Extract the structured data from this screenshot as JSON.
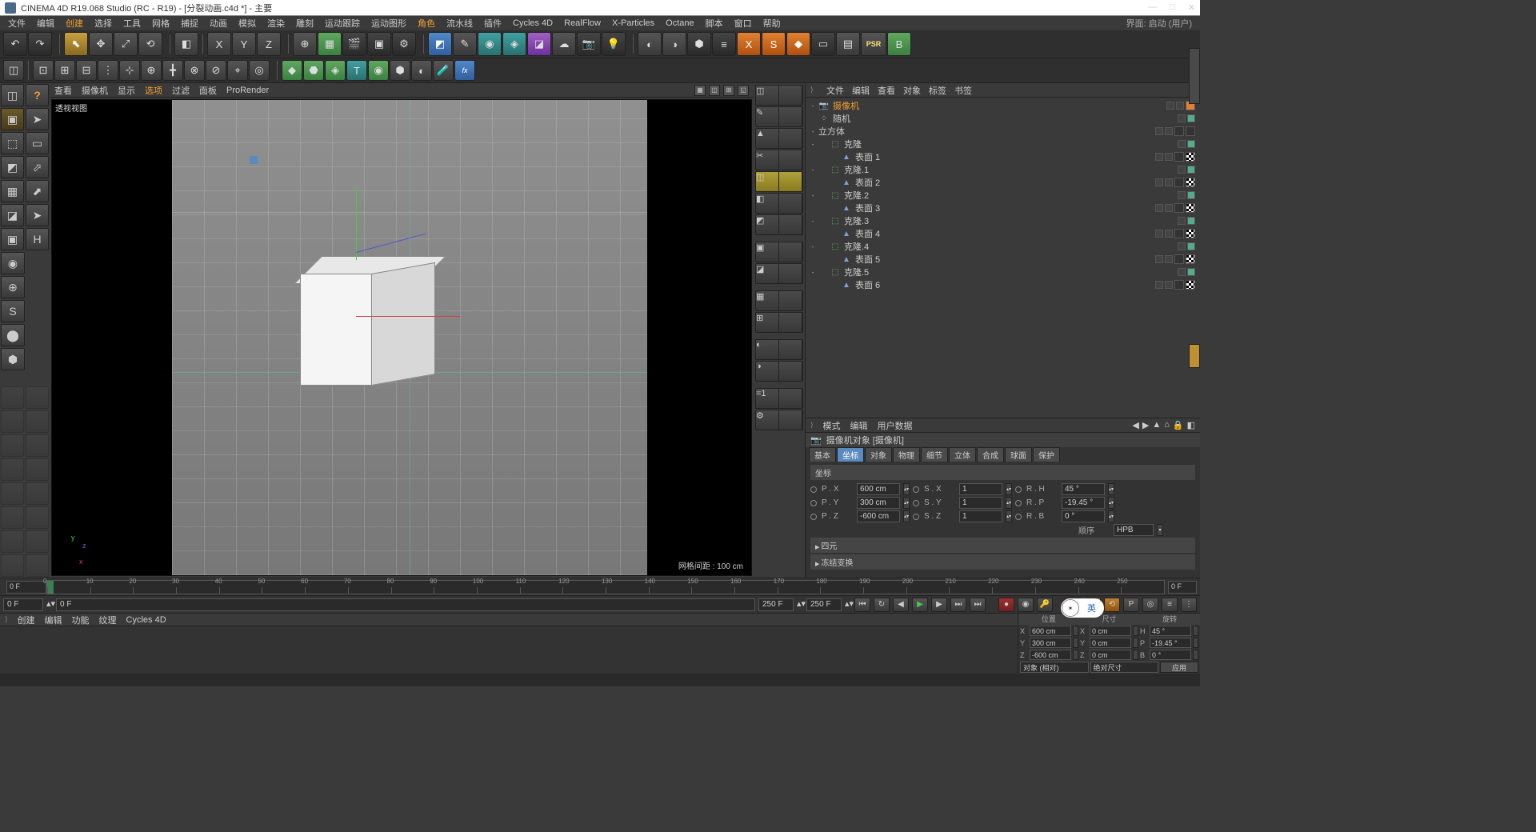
{
  "title": "CINEMA 4D R19.068 Studio (RC - R19) - [分裂动画.c4d *] - 主要",
  "menus": [
    "文件",
    "编辑",
    "创建",
    "选择",
    "工具",
    "网格",
    "捕捉",
    "动画",
    "模拟",
    "渲染",
    "雕刻",
    "运动跟踪",
    "运动图形",
    "角色",
    "流水线",
    "插件",
    "Cycles 4D",
    "RealFlow",
    "X-Particles",
    "Octane",
    "脚本",
    "窗口",
    "帮助"
  ],
  "menu_highlight": [
    2,
    13
  ],
  "layout_label": "界面:",
  "layout_value": "启动 (用户)",
  "viewmenu": [
    "查看",
    "摄像机",
    "显示",
    "选项",
    "过滤",
    "面板",
    "ProRender"
  ],
  "viewmenu_highlight": [
    3
  ],
  "viewport_label": "透视视图",
  "grid_info": "网格间距 : 100 cm",
  "axis": {
    "x": "x",
    "y": "y",
    "z": "z"
  },
  "obj_panel_menu": [
    "文件",
    "编辑",
    "查看",
    "对象",
    "标签",
    "书签"
  ],
  "objects": [
    {
      "depth": 0,
      "exp": "-",
      "icon": "cam",
      "name": "摄像机",
      "sel": true,
      "flags": [
        "d",
        "d"
      ],
      "tags": [
        "o"
      ]
    },
    {
      "depth": 0,
      "exp": "",
      "icon": "rand",
      "name": "随机",
      "flags": [
        "d",
        "g"
      ]
    },
    {
      "depth": 0,
      "exp": "-",
      "icon": "cube",
      "name": "立方体",
      "flags": [
        "d",
        "d"
      ],
      "tags": [
        "t",
        "t"
      ]
    },
    {
      "depth": 1,
      "exp": "-",
      "icon": "clone",
      "name": "克隆",
      "flags": [
        "d",
        "g"
      ]
    },
    {
      "depth": 2,
      "exp": "",
      "icon": "poly",
      "name": "表面 1",
      "flags": [
        "d",
        "d"
      ],
      "tags": [
        "t",
        "chk"
      ]
    },
    {
      "depth": 1,
      "exp": "-",
      "icon": "clone",
      "name": "克隆.1",
      "flags": [
        "d",
        "g"
      ]
    },
    {
      "depth": 2,
      "exp": "",
      "icon": "poly",
      "name": "表面 2",
      "flags": [
        "d",
        "d"
      ],
      "tags": [
        "t",
        "chk"
      ]
    },
    {
      "depth": 1,
      "exp": "-",
      "icon": "clone",
      "name": "克隆.2",
      "flags": [
        "d",
        "g"
      ]
    },
    {
      "depth": 2,
      "exp": "",
      "icon": "poly",
      "name": "表面 3",
      "flags": [
        "d",
        "d"
      ],
      "tags": [
        "t",
        "chk"
      ]
    },
    {
      "depth": 1,
      "exp": "-",
      "icon": "clone",
      "name": "克隆.3",
      "flags": [
        "d",
        "g"
      ]
    },
    {
      "depth": 2,
      "exp": "",
      "icon": "poly",
      "name": "表面 4",
      "flags": [
        "d",
        "d"
      ],
      "tags": [
        "t",
        "chk"
      ]
    },
    {
      "depth": 1,
      "exp": "-",
      "icon": "clone",
      "name": "克隆.4",
      "flags": [
        "d",
        "g"
      ]
    },
    {
      "depth": 2,
      "exp": "",
      "icon": "poly",
      "name": "表面 5",
      "flags": [
        "d",
        "d"
      ],
      "tags": [
        "t",
        "chk"
      ]
    },
    {
      "depth": 1,
      "exp": "-",
      "icon": "clone",
      "name": "克隆.5",
      "flags": [
        "d",
        "g"
      ]
    },
    {
      "depth": 2,
      "exp": "",
      "icon": "poly",
      "name": "表面 6",
      "flags": [
        "d",
        "d"
      ],
      "tags": [
        "t",
        "chk"
      ]
    }
  ],
  "attr_menu": [
    "模式",
    "编辑",
    "用户数据"
  ],
  "attr_obj": "摄像机对象 [摄像机]",
  "attr_tabs": [
    "基本",
    "坐标",
    "对象",
    "物理",
    "细节",
    "立体",
    "合成",
    "球面",
    "保护"
  ],
  "attr_tab_sel": 1,
  "attr_section": "坐标",
  "coords": {
    "px": {
      "l": "P . X",
      "v": "600 cm"
    },
    "sx": {
      "l": "S . X",
      "v": "1"
    },
    "rh": {
      "l": "R . H",
      "v": "45 °"
    },
    "py": {
      "l": "P . Y",
      "v": "300 cm"
    },
    "sy": {
      "l": "S . Y",
      "v": "1"
    },
    "rp": {
      "l": "R . P",
      "v": "-19.45 °"
    },
    "pz": {
      "l": "P . Z",
      "v": "-600 cm"
    },
    "sz": {
      "l": "S . Z",
      "v": "1"
    },
    "rb": {
      "l": "R . B",
      "v": "0 °"
    }
  },
  "order_label": "顺序",
  "order_value": "HPB",
  "collapsible": [
    "四元",
    "冻结变换"
  ],
  "timeline": {
    "start": "0 F",
    "ticks": [
      0,
      10,
      20,
      30,
      40,
      50,
      60,
      70,
      80,
      90,
      100,
      110,
      120,
      130,
      140,
      150,
      160,
      170,
      180,
      190,
      200,
      210,
      220,
      230,
      240,
      250
    ],
    "cur": "0 F",
    "fld": "0 F",
    "end_a": "250 F",
    "end_b": "250 F"
  },
  "mat_menu": [
    "创建",
    "编辑",
    "功能",
    "纹理",
    "Cycles 4D"
  ],
  "bcoord_hdr": [
    "位置",
    "尺寸",
    "旋转"
  ],
  "bcoord": {
    "x": {
      "p": "600 cm",
      "s": "0 cm",
      "r": "45 °"
    },
    "y": {
      "p": "300 cm",
      "s": "0 cm",
      "r": "-19.45 °"
    },
    "z": {
      "p": "-600 cm",
      "s": "0 cm",
      "r": "0 °"
    }
  },
  "bcoord_axes": [
    "X",
    "Y",
    "Z",
    "X",
    "Y",
    "Z",
    "H",
    "P",
    "B"
  ],
  "bcoord_sel": [
    "对象 (相对)",
    "绝对尺寸"
  ],
  "apply": "应用",
  "ime": "英",
  "psr": "PSR"
}
